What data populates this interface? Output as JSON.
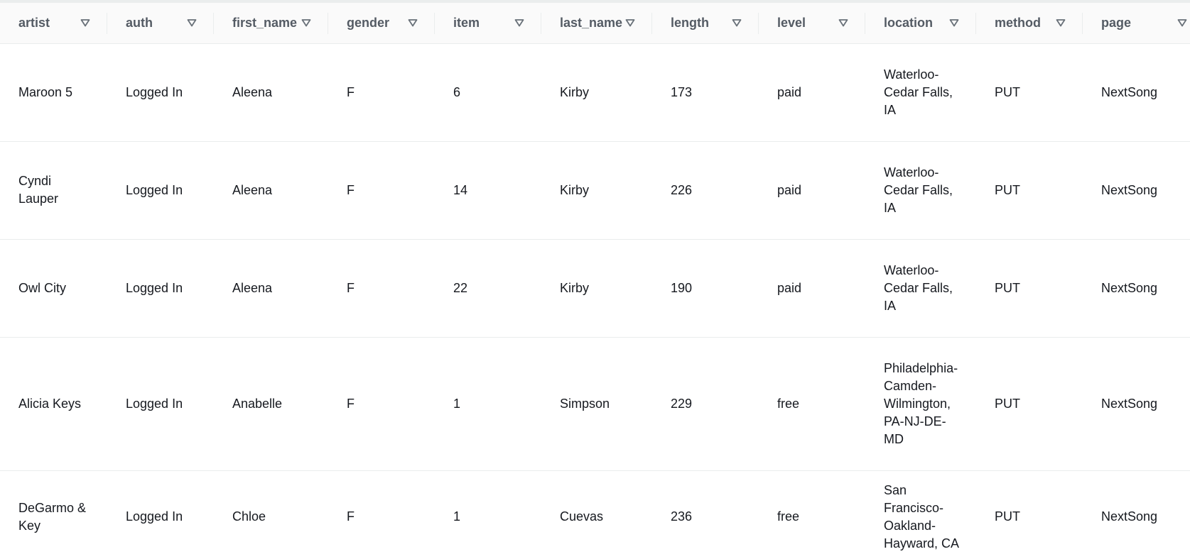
{
  "columns": [
    {
      "key": "artist",
      "label": "artist"
    },
    {
      "key": "auth",
      "label": "auth"
    },
    {
      "key": "first_name",
      "label": "first_name"
    },
    {
      "key": "gender",
      "label": "gender"
    },
    {
      "key": "item",
      "label": "item"
    },
    {
      "key": "last_name",
      "label": "last_name"
    },
    {
      "key": "length",
      "label": "length"
    },
    {
      "key": "level",
      "label": "level"
    },
    {
      "key": "location",
      "label": "location"
    },
    {
      "key": "method",
      "label": "method"
    },
    {
      "key": "page",
      "label": "page"
    }
  ],
  "rows": [
    {
      "artist": "Maroon 5",
      "auth": "Logged In",
      "first_name": "Aleena",
      "gender": "F",
      "item": "6",
      "last_name": "Kirby",
      "length": "173",
      "level": "paid",
      "location": "Waterloo-Cedar Falls, IA",
      "method": "PUT",
      "page": "NextSong"
    },
    {
      "artist": "Cyndi Lauper",
      "auth": "Logged In",
      "first_name": "Aleena",
      "gender": "F",
      "item": "14",
      "last_name": "Kirby",
      "length": "226",
      "level": "paid",
      "location": "Waterloo-Cedar Falls, IA",
      "method": "PUT",
      "page": "NextSong"
    },
    {
      "artist": "Owl City",
      "auth": "Logged In",
      "first_name": "Aleena",
      "gender": "F",
      "item": "22",
      "last_name": "Kirby",
      "length": "190",
      "level": "paid",
      "location": "Waterloo-Cedar Falls, IA",
      "method": "PUT",
      "page": "NextSong"
    },
    {
      "artist": "Alicia Keys",
      "auth": "Logged In",
      "first_name": "Anabelle",
      "gender": "F",
      "item": "1",
      "last_name": "Simpson",
      "length": "229",
      "level": "free",
      "location": "Philadelphia-Camden-Wilmington, PA-NJ-DE-MD",
      "method": "PUT",
      "page": "NextSong"
    },
    {
      "artist": "DeGarmo & Key",
      "auth": "Logged In",
      "first_name": "Chloe",
      "gender": "F",
      "item": "1",
      "last_name": "Cuevas",
      "length": "236",
      "level": "free",
      "location": "San Francisco-Oakland-Hayward, CA",
      "method": "PUT",
      "page": "NextSong"
    }
  ],
  "icons": {
    "sort": "sort-caret-down-icon"
  },
  "colors": {
    "header_text": "#545b64",
    "border": "#eaeded",
    "text": "#16191f",
    "icon": "#687078"
  }
}
